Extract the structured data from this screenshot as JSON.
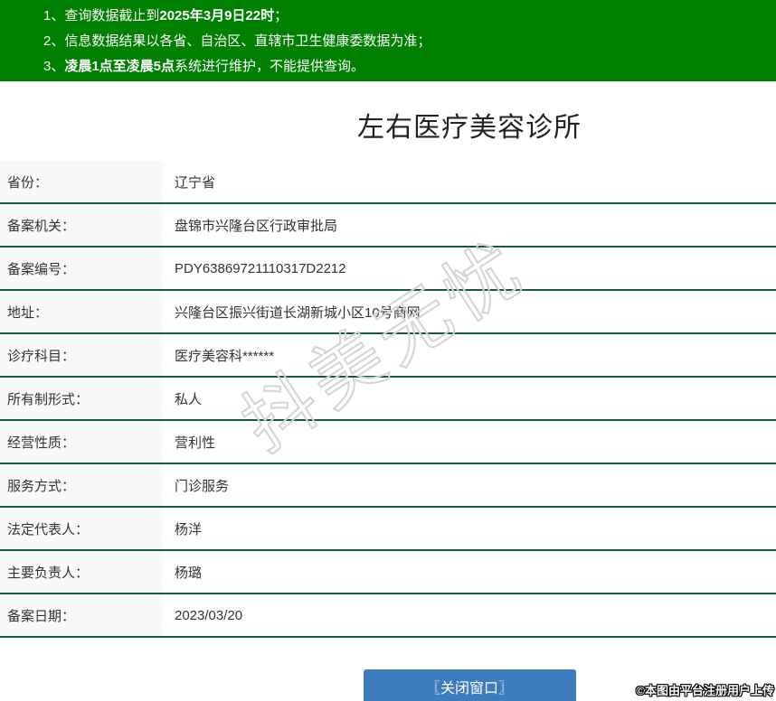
{
  "notices": {
    "items": [
      {
        "num": "1、",
        "pre": "查询数据截止到",
        "bold": "2025年3月9日22时",
        "post": "；"
      },
      {
        "num": "2、",
        "pre": "信息数据结果以各省、自治区、直辖市卫生健康委数据为准；",
        "bold": "",
        "post": ""
      },
      {
        "num": "3、",
        "pre": "",
        "bold": "凌晨1点至凌晨5点",
        "post": "系统进行维护，不能提供查询。"
      }
    ]
  },
  "title": "左右医疗美容诊所",
  "table": {
    "rows": [
      {
        "label": "省份：",
        "value": "辽宁省"
      },
      {
        "label": "备案机关：",
        "value": "盘锦市兴隆台区行政审批局"
      },
      {
        "label": "备案编号：",
        "value": "PDY63869721110317D2212"
      },
      {
        "label": "地址：",
        "value": "兴隆台区振兴街道长湖新城小区10号商网"
      },
      {
        "label": "诊疗科目：",
        "value": "医疗美容科******"
      },
      {
        "label": "所有制形式：",
        "value": "私人"
      },
      {
        "label": "经营性质：",
        "value": "营利性"
      },
      {
        "label": "服务方式：",
        "value": "门诊服务"
      },
      {
        "label": "法定代表人：",
        "value": "杨洋"
      },
      {
        "label": "主要负责人：",
        "value": "杨璐"
      },
      {
        "label": "备案日期：",
        "value": "2023/03/20"
      }
    ]
  },
  "watermarks": {
    "diagonal": "抖美无忧",
    "corner": "©本图由平台注册用户上传"
  },
  "footer": {
    "close_label": "〖关闭窗口〗"
  },
  "colors": {
    "header_green": "#008000",
    "divider_green": "#14593c",
    "button_blue": "#3d7dbd",
    "label_bg": "#f9f9f9"
  }
}
